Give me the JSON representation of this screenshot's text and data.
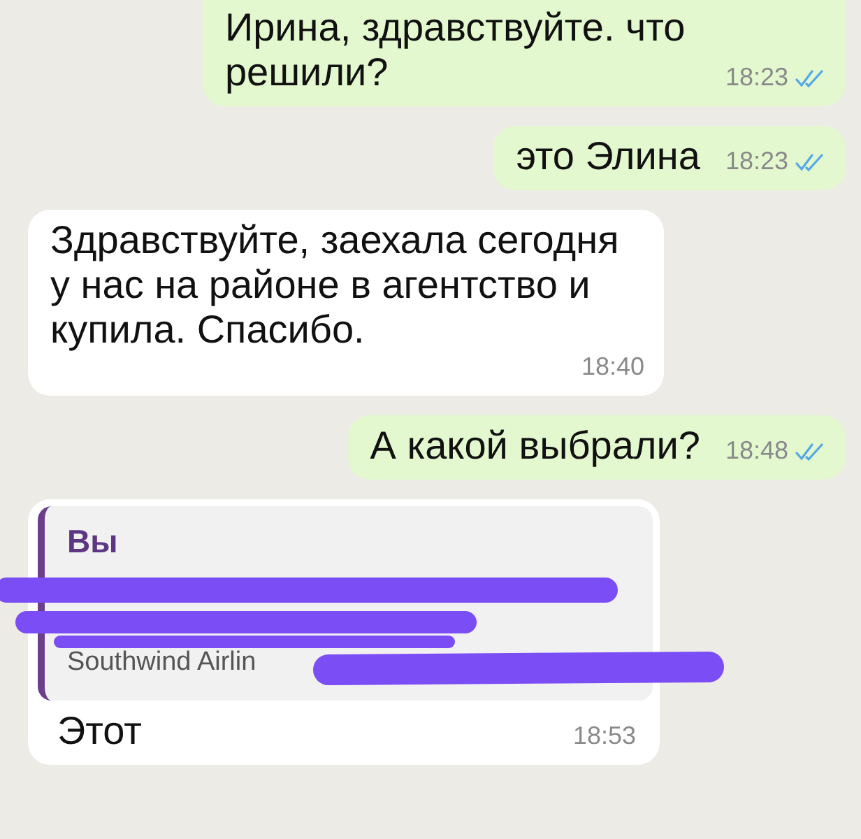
{
  "messages": [
    {
      "outgoing": true,
      "text": "Ирина, здравствуйте. что решили?",
      "time": "18:23",
      "read": true
    },
    {
      "outgoing": true,
      "text": "это Элина",
      "time": "18:23",
      "read": true
    },
    {
      "outgoing": false,
      "text": "Здравствуйте, заехала сегодня у нас на районе в агентство и купила. Спасибо.",
      "time": "18:40"
    },
    {
      "outgoing": true,
      "text": "А какой выбрали?",
      "time": "18:48",
      "read": true
    },
    {
      "outgoing": false,
      "reply": {
        "author": "Вы",
        "text": "Southwind Airlin"
      },
      "text": "Этот",
      "time": "18:53"
    }
  ]
}
